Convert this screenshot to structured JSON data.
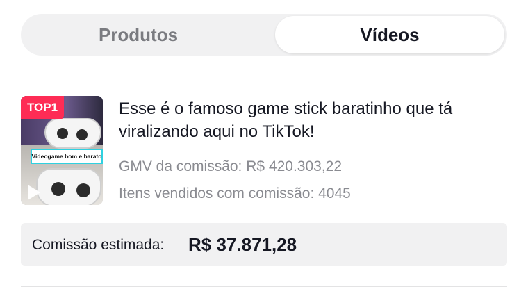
{
  "tabs": {
    "products_label": "Produtos",
    "videos_label": "Vídeos",
    "selected": "Vídeos"
  },
  "video": {
    "thumbnail": {
      "badge": "TOP1",
      "caption": "Videogame bom e barato",
      "icon": "play-icon"
    },
    "title": "Esse é o famoso game stick baratinho que tá viralizando aqui no TikTok!",
    "gmv": "GMV da comissão: R$ 420.303,22",
    "items_sold": "Itens vendidos com comissão: 4045"
  },
  "commission": {
    "label": "Comissão estimada:",
    "value": "R$ 37.871,28"
  },
  "colors": {
    "badge": "#fe2c55",
    "muted_text": "#8a8b91",
    "panel_bg": "#f1f1f2"
  }
}
